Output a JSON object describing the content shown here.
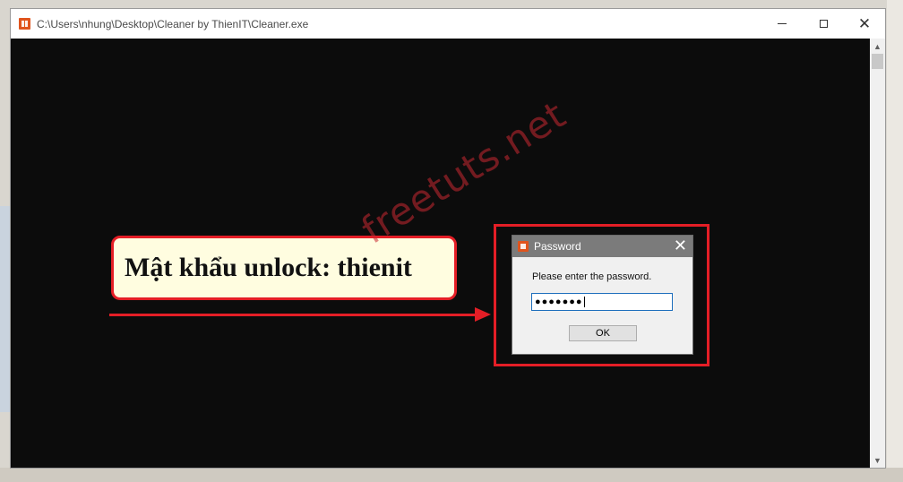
{
  "window": {
    "title": "C:\\Users\\nhung\\Desktop\\Cleaner by ThienIT\\Cleaner.exe",
    "minimize_glyph": "",
    "close_glyph": "✕"
  },
  "annotation": {
    "callout_text": "Mật khẩu unlock: thienit",
    "accent_color": "#e41e26"
  },
  "dialog": {
    "title": "Password",
    "close_glyph": "✕",
    "prompt": "Please enter the password.",
    "password_masked": "●●●●●●●",
    "ok_label": "OK"
  },
  "watermark": {
    "text": "freetuts.net"
  },
  "icons": [
    "app-icon",
    "minimize-icon",
    "maximize-icon",
    "close-icon",
    "scroll-up-icon",
    "scroll-down-icon"
  ]
}
